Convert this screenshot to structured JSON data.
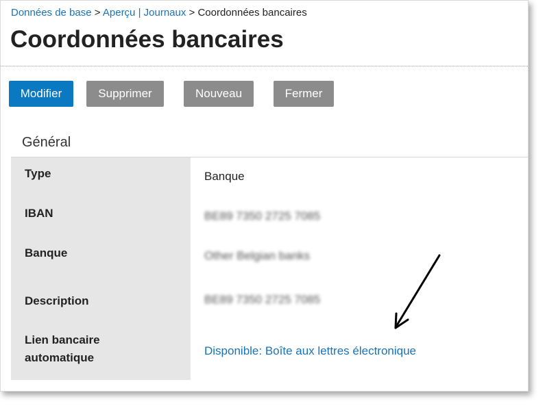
{
  "breadcrumb": {
    "item1": "Données de base",
    "sep1": " > ",
    "item2": "Aperçu | Journaux",
    "sep2": " > ",
    "current": "Coordonnées bancaires"
  },
  "page": {
    "title": "Coordonnées bancaires"
  },
  "toolbar": {
    "modify_label": "Modifier",
    "delete_label": "Supprimer",
    "new_label": "Nouveau",
    "close_label": "Fermer"
  },
  "section": {
    "title": "Général",
    "rows": [
      {
        "label": "Type",
        "value": "Banque"
      },
      {
        "label": "IBAN",
        "value": "BE89 7350 2725 7085"
      },
      {
        "label": "Banque",
        "value": "Other Belgian banks"
      },
      {
        "label": "Description",
        "value": "BE89 7350 2725 7085"
      },
      {
        "label_line1": "Lien bancaire",
        "label_line2": "automatique",
        "value": "Disponible: Boîte aux lettres électronique"
      }
    ]
  },
  "colors": {
    "primary_button": "#0b78c2",
    "secondary_button": "#8c8c8c",
    "link": "#1a73b8",
    "label_column_bg": "#e6e6e6"
  },
  "icons": {
    "annotation": "arrow-annotation-icon"
  }
}
